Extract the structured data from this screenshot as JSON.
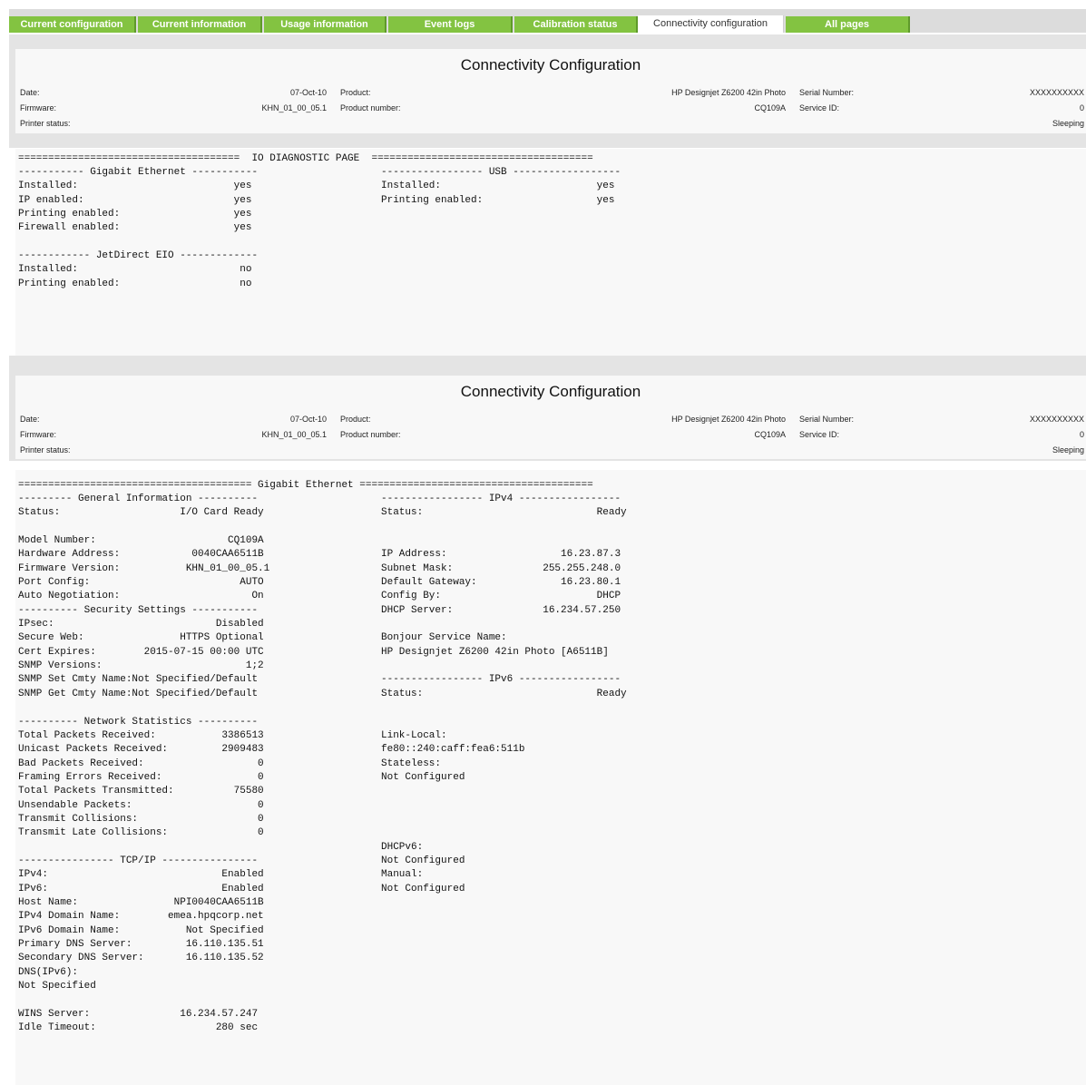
{
  "tabs": [
    {
      "label": "Current configuration"
    },
    {
      "label": "Current information"
    },
    {
      "label": "Usage information"
    },
    {
      "label": "Event logs"
    },
    {
      "label": "Calibration status"
    },
    {
      "label": "Connectivity configuration"
    },
    {
      "label": "All pages"
    }
  ],
  "colors": {
    "tab_green": "#83c341",
    "band": "#e4e4e4",
    "panel": "#f8f8f8"
  },
  "header": {
    "title": "Connectivity Configuration",
    "date_label": "Date:",
    "date_value": "07-Oct-10",
    "firmware_label": "Firmware:",
    "firmware_value": "KHN_01_00_05.1",
    "printer_status_label": "Printer status:",
    "product_label": "Product:",
    "product_value": "HP Designjet Z6200 42in Photo",
    "product_number_label": "Product number:",
    "product_number_value": "CQ109A",
    "serial_label": "Serial Number:",
    "serial_value": "XXXXXXXXXX",
    "service_id_label": "Service ID:",
    "service_id_value": "0",
    "status_value": "Sleeping"
  },
  "io_report": {
    "title_line": "=====================================  IO DIAGNOSTIC PAGE  =====================================",
    "left": [
      "----------- Gigabit Ethernet -----------",
      "Installed:                          yes",
      "IP enabled:                         yes",
      "Printing enabled:                   yes",
      "Firewall enabled:                   yes",
      "",
      "------------ JetDirect EIO -------------",
      "Installed:                           no",
      "Printing enabled:                    no"
    ],
    "right": [
      "----------------- USB ------------------",
      "Installed:                          yes",
      "Printing enabled:                   yes"
    ]
  },
  "ge_report": {
    "title_line": "======================================= Gigabit Ethernet =======================================",
    "left": [
      "--------- General Information ----------",
      "Status:                    I/O Card Ready",
      "",
      "Model Number:                      CQ109A",
      "Hardware Address:            0040CAA6511B",
      "Firmware Version:           KHN_01_00_05.1",
      "Port Config:                         AUTO",
      "Auto Negotiation:                      On",
      "---------- Security Settings -----------",
      "IPsec:                           Disabled",
      "Secure Web:                HTTPS Optional",
      "Cert Expires:        2015-07-15 00:00 UTC",
      "SNMP Versions:                        1;2",
      "SNMP Set Cmty Name:Not Specified/Default",
      "SNMP Get Cmty Name:Not Specified/Default",
      "",
      "---------- Network Statistics ----------",
      "Total Packets Received:           3386513",
      "Unicast Packets Received:         2909483",
      "Bad Packets Received:                   0",
      "Framing Errors Received:                0",
      "Total Packets Transmitted:          75580",
      "Unsendable Packets:                     0",
      "Transmit Collisions:                    0",
      "Transmit Late Collisions:               0",
      "",
      "---------------- TCP/IP ----------------",
      "IPv4:                             Enabled",
      "IPv6:                             Enabled",
      "Host Name:                NPI0040CAA6511B",
      "IPv4 Domain Name:        emea.hpqcorp.net",
      "IPv6 Domain Name:           Not Specified",
      "Primary DNS Server:         16.110.135.51",
      "Secondary DNS Server:       16.110.135.52",
      "DNS(IPv6):",
      "Not Specified",
      "",
      "WINS Server:               16.234.57.247",
      "Idle Timeout:                    280 sec"
    ],
    "right": [
      "----------------- IPv4 -----------------",
      "Status:                             Ready",
      "",
      "",
      "IP Address:                   16.23.87.3",
      "Subnet Mask:               255.255.248.0",
      "Default Gateway:              16.23.80.1",
      "Config By:                          DHCP",
      "DHCP Server:               16.234.57.250",
      "",
      "Bonjour Service Name:",
      "HP Designjet Z6200 42in Photo [A6511B]",
      "",
      "----------------- IPv6 -----------------",
      "Status:                             Ready",
      "",
      "",
      "Link-Local:",
      "fe80::240:caff:fea6:511b",
      "Stateless:",
      "Not Configured",
      "",
      "",
      "",
      "",
      "DHCPv6:",
      "Not Configured",
      "Manual:",
      "Not Configured"
    ]
  }
}
